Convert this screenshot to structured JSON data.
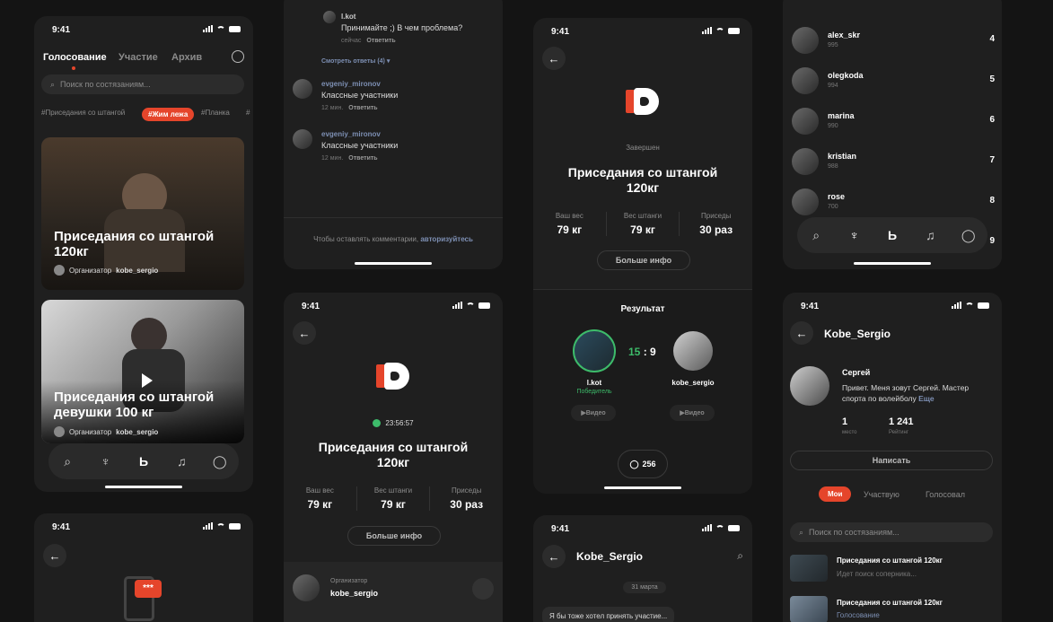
{
  "status_time": "9:41",
  "phone1": {
    "tabs": [
      "Голосование",
      "Участие",
      "Архив"
    ],
    "search_placeholder": "Поиск по состязаниям...",
    "tags": [
      "#Приседания со штангой",
      "#Жим лежа",
      "#Планка",
      "#"
    ],
    "cards": [
      {
        "title_l1": "Приседания со штангой",
        "title_l2": "120кг",
        "org_prefix": "Организатор",
        "org_name": "kobe_sergio"
      },
      {
        "title_l1": "Приседания со штангой",
        "title_l2": "девушки 100 кг",
        "org_prefix": "Организатор",
        "org_name": "kobe_sergio"
      }
    ]
  },
  "phone1b": {
    "dots": "***"
  },
  "phone2": {
    "reply": {
      "name": "l.kot",
      "text": "Принимайте ;) В чем проблема?",
      "time": "сейчас",
      "action": "Ответить"
    },
    "see_replies": "Смотреть ответы (4)",
    "comments": [
      {
        "name": "evgeniy_mironov",
        "text": "Классные участники",
        "time": "12 мин.",
        "action": "Ответить"
      },
      {
        "name": "evgeniy_mironov",
        "text": "Классные участники",
        "time": "12 мин.",
        "action": "Ответить"
      }
    ],
    "footer_text": "Чтобы оставлять комментарии,",
    "footer_link": "авторизуйтесь"
  },
  "phone3": {
    "timer": "23:56:57",
    "title_l1": "Приседания со штангой",
    "title_l2": "120кг",
    "stats": [
      {
        "label": "Ваш вес",
        "value": "79 кг"
      },
      {
        "label": "Вес штанги",
        "value": "79 кг"
      },
      {
        "label": "Приседы",
        "value": "30 раз"
      }
    ],
    "more": "Больше инфо",
    "org_label": "Организатор",
    "org_name": "kobe_sergio"
  },
  "phone4": {
    "status": "Завершен",
    "title_l1": "Приседания со штангой",
    "title_l2": "120кг",
    "stats": [
      {
        "label": "Ваш вес",
        "value": "79 кг"
      },
      {
        "label": "Вес штанги",
        "value": "79 кг"
      },
      {
        "label": "Приседы",
        "value": "30 раз"
      }
    ],
    "more": "Больше инфо",
    "result_title": "Результат",
    "p1_name": "l.kot",
    "p1_status": "Победитель",
    "score_a": "15",
    "score_sep": ":",
    "score_b": "9",
    "p2_name": "kobe_sergio",
    "video": "Видео",
    "comments_count": "256"
  },
  "phone5": {
    "title": "Kobe_Sergio",
    "date": "31 марта",
    "message": "Я бы тоже хотел принять участие..."
  },
  "phone6": {
    "rows": [
      {
        "name": "alex_skr",
        "score": "995",
        "rank": "4"
      },
      {
        "name": "olegkoda",
        "score": "994",
        "rank": "5"
      },
      {
        "name": "marina",
        "score": "990",
        "rank": "6"
      },
      {
        "name": "kristian",
        "score": "988",
        "rank": "7"
      },
      {
        "name": "rose",
        "score": "700",
        "rank": "8"
      },
      {
        "name": "",
        "score": "",
        "rank": "9"
      }
    ]
  },
  "phone7": {
    "title": "Kobe_Sergio",
    "first_name": "Сергей",
    "bio": "Привет. Меня зовут Сергей. Мастер спорта по волейболу",
    "more": "Еще",
    "place_value": "1",
    "place_label": "место",
    "rating_value": "1 241",
    "rating_label": "Рейтинг",
    "write": "Написать",
    "tabs": [
      "Мои",
      "Участвую",
      "Голосовал"
    ],
    "search_placeholder": "Поиск по состязаниям...",
    "items": [
      {
        "title": "Приседания со штангой 120кг",
        "sub": "Идет поиск соперника..."
      },
      {
        "title": "Приседания со штангой 120кг",
        "sub": "Голосование"
      }
    ]
  },
  "colors": {
    "accent": "#e5452b",
    "win": "#3dbb6a",
    "link": "#7d8fb3"
  }
}
